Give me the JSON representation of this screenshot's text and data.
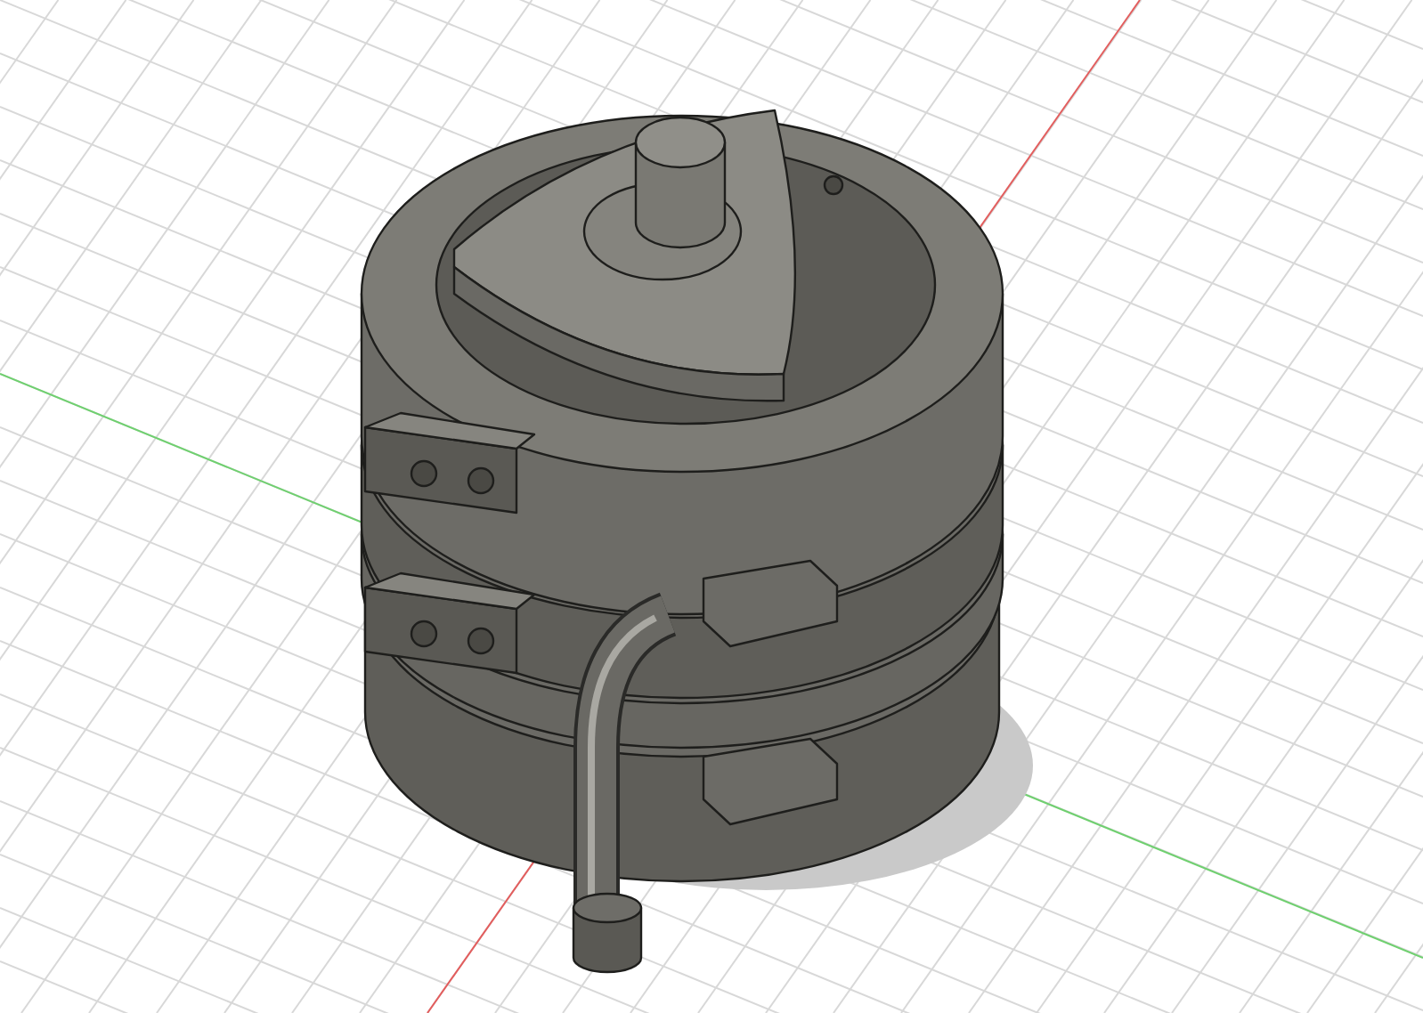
{
  "viewport": {
    "grid": true,
    "axes": [
      {
        "kind": "x",
        "color": "#e35d5d"
      },
      {
        "kind": "y",
        "color": "#6fd06f"
      }
    ]
  }
}
